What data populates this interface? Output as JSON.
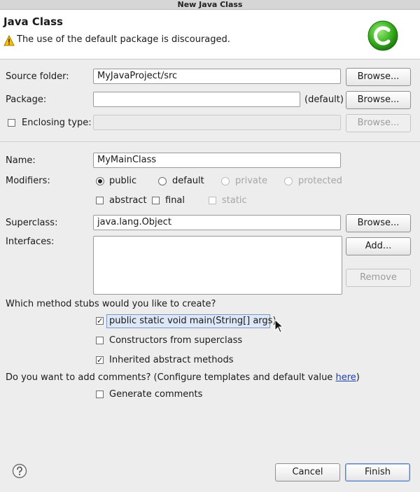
{
  "window": {
    "title": "New Java Class"
  },
  "header": {
    "title": "Java Class",
    "message": "The use of the default package is discouraged."
  },
  "form": {
    "source_folder": {
      "label": "Source folder:",
      "value": "MyJavaProject/src",
      "browse": "Browse..."
    },
    "package": {
      "label": "Package:",
      "value": "",
      "hint": "(default)",
      "browse": "Browse..."
    },
    "enclosing_type": {
      "label": "Enclosing type:",
      "checked": false,
      "value": "",
      "browse": "Browse..."
    },
    "name": {
      "label": "Name:",
      "value": "MyMainClass"
    },
    "modifiers": {
      "label": "Modifiers:",
      "radios": [
        {
          "label": "public",
          "selected": true,
          "enabled": true
        },
        {
          "label": "default",
          "selected": false,
          "enabled": true
        },
        {
          "label": "private",
          "selected": false,
          "enabled": false
        },
        {
          "label": "protected",
          "selected": false,
          "enabled": false
        }
      ],
      "checks": [
        {
          "label": "abstract",
          "checked": false,
          "enabled": true
        },
        {
          "label": "final",
          "checked": false,
          "enabled": true
        },
        {
          "label": "static",
          "checked": false,
          "enabled": false
        }
      ]
    },
    "superclass": {
      "label": "Superclass:",
      "value": "java.lang.Object",
      "browse": "Browse..."
    },
    "interfaces": {
      "label": "Interfaces:",
      "add": "Add...",
      "remove": "Remove"
    },
    "stubs": {
      "question": "Which method stubs would you like to create?",
      "options": [
        {
          "label": "public static void main(String[] args)",
          "checked": true
        },
        {
          "label": "Constructors from superclass",
          "checked": false
        },
        {
          "label": "Inherited abstract methods",
          "checked": true
        }
      ]
    },
    "comments": {
      "question": "Do you want to add comments? (Configure templates and default value ",
      "link": "here",
      "question_end": ")",
      "option": {
        "label": "Generate comments",
        "checked": false
      }
    }
  },
  "footer": {
    "cancel": "Cancel",
    "finish": "Finish"
  },
  "colors": {
    "logo_green": "#3cb521",
    "warning_yellow": "#f4c20d",
    "link_blue": "#1a3eb5"
  }
}
